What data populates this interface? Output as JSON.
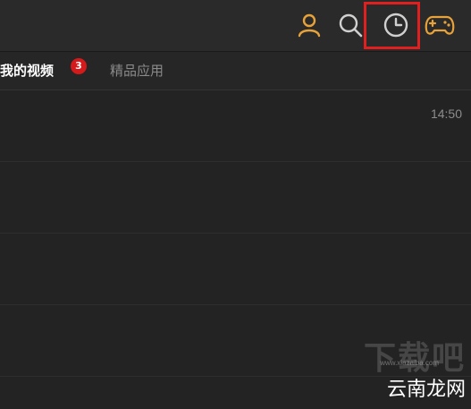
{
  "header": {
    "icons": [
      "user-icon",
      "search-icon",
      "clock-icon",
      "gamepad-icon"
    ],
    "accent_color": "#e8a23a",
    "highlight_color": "#e01f1f"
  },
  "tabs": [
    {
      "label": "我的视频",
      "badge": "3",
      "active": true
    },
    {
      "label": "精品应用",
      "active": false
    }
  ],
  "list": {
    "rows": [
      {
        "time": "14:50"
      },
      {
        "time": ""
      },
      {
        "time": ""
      },
      {
        "time": ""
      }
    ]
  },
  "watermark": {
    "main": "下载吧",
    "sub": "www.xiazaiba.com",
    "brand": "云南龙网"
  }
}
